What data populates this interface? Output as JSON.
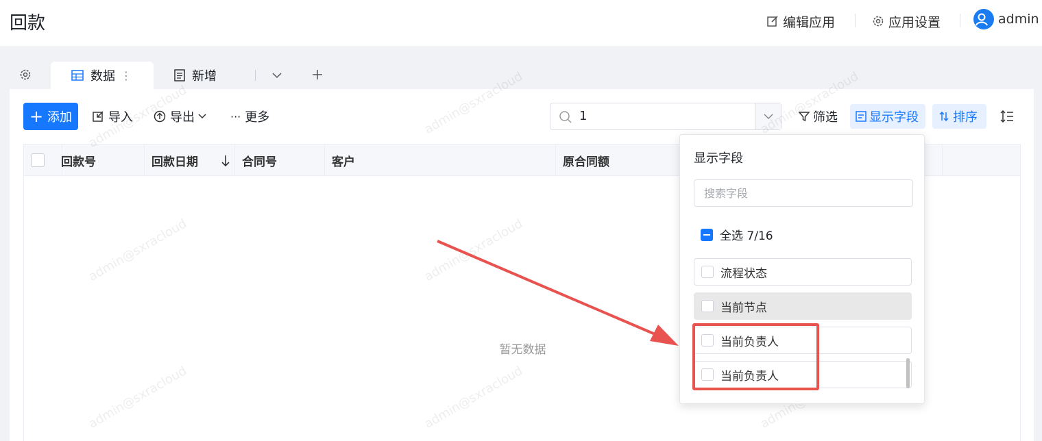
{
  "app": {
    "title": "回款"
  },
  "header": {
    "edit_app": "编辑应用",
    "app_settings": "应用设置",
    "user": "admin"
  },
  "tabs": [
    {
      "label": "数据",
      "icon": "table-icon",
      "active": true
    },
    {
      "label": "新增",
      "icon": "form-icon",
      "active": false
    }
  ],
  "toolbar": {
    "add": "添加",
    "import": "导入",
    "export": "导出",
    "more": "更多",
    "search_value": "1",
    "filter": "筛选",
    "show_fields": "显示字段",
    "sort": "排序"
  },
  "table": {
    "columns": [
      "回款号",
      "回款日期",
      "合同号",
      "客户",
      "原合同额"
    ],
    "empty_text": "暂无数据"
  },
  "field_panel": {
    "title": "显示字段",
    "search_placeholder": "搜索字段",
    "select_all": "全选 7/16",
    "fields": [
      "流程状态",
      "当前节点",
      "当前负责人",
      "当前负责人"
    ]
  },
  "watermark": "admin@sxracloud",
  "colors": {
    "primary": "#1677ff",
    "annotation": "#e8534f"
  }
}
